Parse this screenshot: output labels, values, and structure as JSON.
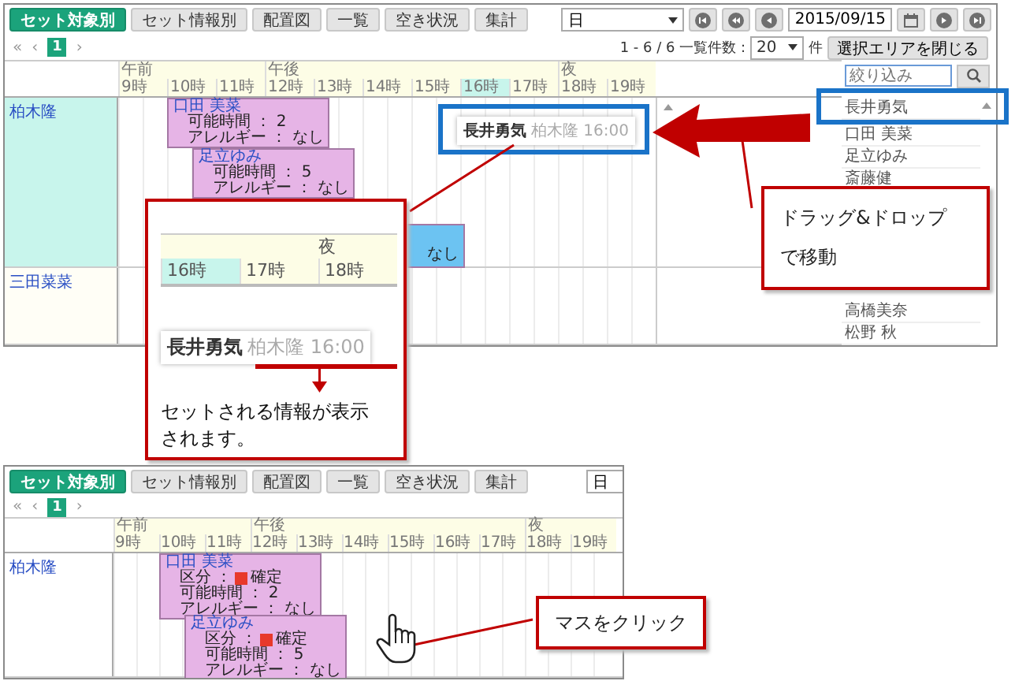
{
  "panels": [
    {
      "tabs": [
        {
          "label": "セット対象別",
          "selected": true
        },
        {
          "label": "セット情報別",
          "selected": false
        },
        {
          "label": "配置図",
          "selected": false
        },
        {
          "label": "一覧",
          "selected": false
        },
        {
          "label": "空き状況",
          "selected": false
        },
        {
          "label": "集計",
          "selected": false
        }
      ],
      "view_select": "日",
      "date_nav": {
        "date": "2015/09/15"
      },
      "pager": {
        "first": "«",
        "prev": "‹",
        "pages": [
          {
            "label": "1",
            "selected": true
          }
        ],
        "next": "›",
        "summary": "1 - 6 / 6 一覧件数 :",
        "page_size": "20",
        "unit": "件",
        "close_button": "選択エリアを閉じる"
      },
      "periods": [
        {
          "label": "午前",
          "hours": [
            {
              "label": "9時",
              "highlighted": false
            },
            {
              "label": "10時",
              "highlighted": false
            },
            {
              "label": "11時",
              "highlighted": false
            }
          ]
        },
        {
          "label": "午後",
          "hours": [
            {
              "label": "12時",
              "highlighted": false
            },
            {
              "label": "13時",
              "highlighted": false
            },
            {
              "label": "14時",
              "highlighted": false
            },
            {
              "label": "15時",
              "highlighted": false
            },
            {
              "label": "16時",
              "highlighted": true
            },
            {
              "label": "17時",
              "highlighted": false
            }
          ]
        },
        {
          "label": "夜",
          "hours": [
            {
              "label": "18時",
              "highlighted": false
            },
            {
              "label": "19時",
              "highlighted": false
            }
          ]
        }
      ],
      "rows": [
        {
          "name": "柏木隆",
          "highlighted": true,
          "events": [
            {
              "name": "口田 美菜",
              "color": "#e6b4e6",
              "lines": [
                {
                  "label": "可能時間 ： 2"
                },
                {
                  "label": "アレルギー ： なし"
                }
              ]
            },
            {
              "name": "足立ゆみ",
              "color": "#e6b4e6",
              "lines": [
                {
                  "label": "可能時間 ： 5"
                },
                {
                  "label": "アレルギー ： なし"
                }
              ]
            },
            {
              "color": "#6cc3f2",
              "lines": [
                {
                  "label": "なし"
                }
              ]
            }
          ]
        },
        {
          "name": "三田菜菜",
          "highlighted": false,
          "events": []
        }
      ],
      "side_list": {
        "search_placeholder": "絞り込み",
        "items": [
          "長井勇気",
          "口田 美菜",
          "足立ゆみ",
          "斎藤健",
          "高橋美奈",
          "松野 秋"
        ]
      }
    },
    {
      "tabs": [
        {
          "label": "セット対象別",
          "selected": true
        },
        {
          "label": "セット情報別",
          "selected": false
        },
        {
          "label": "配置図",
          "selected": false
        },
        {
          "label": "一覧",
          "selected": false
        },
        {
          "label": "空き状況",
          "selected": false
        },
        {
          "label": "集計",
          "selected": false
        }
      ],
      "view_select": "日",
      "pager": {
        "first": "«",
        "prev": "‹",
        "pages": [
          {
            "label": "1",
            "selected": true
          }
        ],
        "next": "›"
      },
      "periods": [
        {
          "label": "午前",
          "hours": [
            {
              "label": "9時",
              "highlighted": false
            },
            {
              "label": "10時",
              "highlighted": false
            },
            {
              "label": "11時",
              "highlighted": false
            }
          ]
        },
        {
          "label": "午後",
          "hours": [
            {
              "label": "12時",
              "highlighted": false
            },
            {
              "label": "13時",
              "highlighted": false
            },
            {
              "label": "14時",
              "highlighted": false
            },
            {
              "label": "15時",
              "highlighted": false
            },
            {
              "label": "16時",
              "highlighted": false
            },
            {
              "label": "17時",
              "highlighted": false
            }
          ]
        },
        {
          "label": "夜",
          "hours": [
            {
              "label": "18時",
              "highlighted": false
            },
            {
              "label": "19時",
              "highlighted": false
            }
          ]
        }
      ],
      "rows": [
        {
          "name": "柏木隆",
          "highlighted": false,
          "events": [
            {
              "name": "口田 美菜",
              "color": "#e6b4e6",
              "lines": [
                {
                  "label": "区分 ：",
                  "status": "確定",
                  "color": "#e8392b"
                },
                {
                  "label": "可能時間 ： 2"
                },
                {
                  "label": "アレルギー ： なし"
                }
              ]
            },
            {
              "name": "足立ゆみ",
              "color": "#e6b4e6",
              "lines": [
                {
                  "label": "区分 ：",
                  "status": "確定",
                  "color": "#e8392b"
                },
                {
                  "label": "可能時間 ： 5"
                },
                {
                  "label": "アレルギー ： なし"
                }
              ]
            }
          ]
        }
      ]
    }
  ],
  "annotations": {
    "drag_ghost": {
      "name": "長井勇気",
      "detail": "柏木隆 16:00"
    },
    "zoom_callout": {
      "period": "夜",
      "hours": [
        {
          "label": "16時",
          "highlighted": true
        },
        {
          "label": "17時",
          "highlighted": false
        },
        {
          "label": "18時",
          "highlighted": false
        }
      ],
      "ghost": {
        "name": "長井勇気",
        "detail": "柏木隆 16:00"
      },
      "caption": "セットされる情報が表示されます。"
    },
    "notes": [
      {
        "lines": [
          "ドラッグ&ドロップ",
          "で移動"
        ]
      },
      {
        "lines": [
          "マスをクリック"
        ]
      }
    ]
  }
}
